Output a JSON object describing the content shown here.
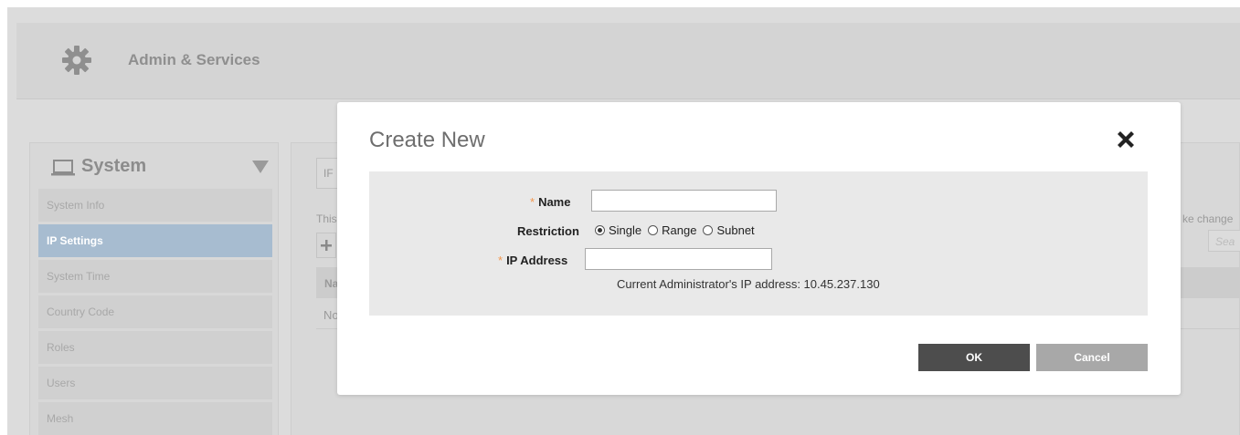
{
  "header": {
    "title": "Admin & Services",
    "icon": "gear-icon"
  },
  "sidebar": {
    "section_title": "System",
    "section_icon": "laptop-icon",
    "items": [
      {
        "label": "System Info",
        "active": false
      },
      {
        "label": "IP Settings",
        "active": true
      },
      {
        "label": "System Time",
        "active": false
      },
      {
        "label": "Country Code",
        "active": false
      },
      {
        "label": "Roles",
        "active": false
      },
      {
        "label": "Users",
        "active": false
      },
      {
        "label": "Mesh",
        "active": false
      }
    ]
  },
  "background": {
    "tab_fragment": "IF",
    "desc_fragment": "This",
    "desc_right_fragment": "ke change",
    "search_fragment": "Sea",
    "table_header_fragment": "Na",
    "table_row_fragment": "No",
    "add_icon": "plus-icon"
  },
  "modal": {
    "title": "Create New",
    "close_icon": "close-icon",
    "required_marker": "*",
    "name_label": "Name",
    "name_value": "",
    "restriction_label": "Restriction",
    "restriction_options": [
      "Single",
      "Range",
      "Subnet"
    ],
    "restriction_selected": "Single",
    "ip_label": "IP Address",
    "ip_value": "",
    "hint": "Current Administrator's IP address: 10.45.237.130",
    "ok_label": "OK",
    "cancel_label": "Cancel"
  },
  "colors": {
    "accent_active_nav": "#a7bcd0",
    "required": "#f3984f",
    "ok_button": "#4d4d4d",
    "cancel_button": "#a8a8a8"
  }
}
